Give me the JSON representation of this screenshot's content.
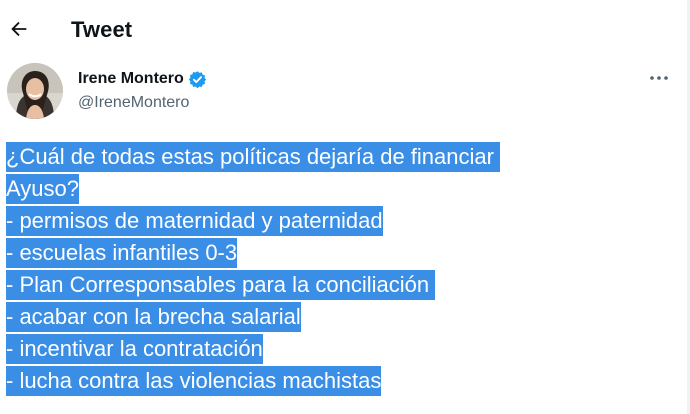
{
  "header": {
    "back_icon": "arrow-left-icon",
    "title": "Tweet"
  },
  "author": {
    "name": "Irene Montero",
    "handle": "@IreneMontero",
    "verified_icon": "verified-badge-icon",
    "avatar_icon": "profile-photo"
  },
  "more_icon": "more-horizontal-icon",
  "tweet": {
    "lines": [
      "¿Cuál de todas estas políticas dejaría de financiar ",
      "Ayuso?",
      "- permisos de maternidad y paternidad",
      "- escuelas infantiles 0-3",
      "- Plan Corresponsables para la conciliación ",
      "- acabar con la brecha salarial",
      "- incentivar la contratación",
      "- lucha contra las violencias machistas"
    ],
    "selection_color": "#3a8ee6"
  }
}
